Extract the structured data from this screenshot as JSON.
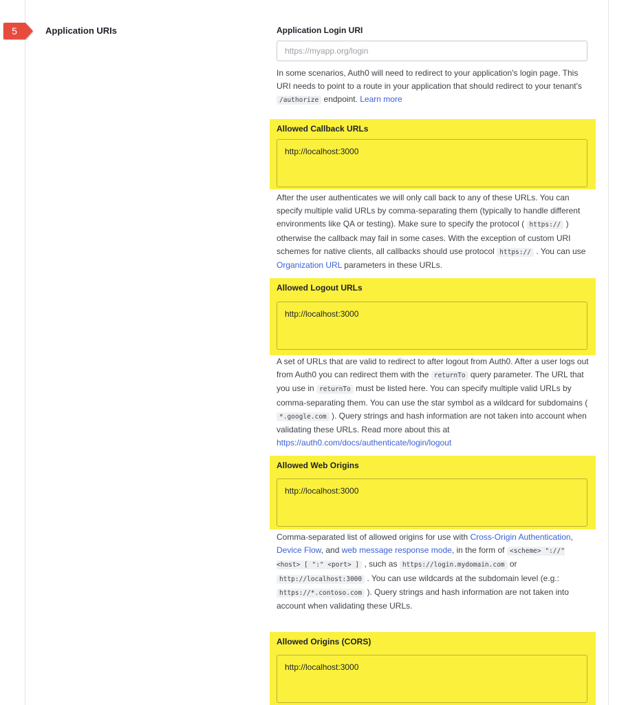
{
  "section": {
    "step_number": "5",
    "title": "Application URIs",
    "colors": {
      "badge": "#e74c3c",
      "highlight": "#fbf13c",
      "link": "#3b5fd6"
    }
  },
  "login_uri": {
    "label": "Application Login URI",
    "placeholder": "https://myapp.org/login",
    "help": {
      "t1": "In some scenarios, Auth0 will need to redirect to your application's login page. This URI needs to point to a route in your application that should redirect to your tenant's ",
      "c1": "/authorize",
      "t2": " endpoint. ",
      "link": "Learn more"
    }
  },
  "callback": {
    "label": "Allowed Callback URLs",
    "value": "http://localhost:3000",
    "help": {
      "t1": "After the user authenticates we will only call back to any of these URLs. You can specify multiple valid URLs by comma-separating them (typically to handle different environments like QA or testing). Make sure to specify the protocol ( ",
      "c1": "https://",
      "t2": " ) otherwise the callback may fail in some cases. With the exception of custom URI schemes for native clients, all callbacks should use protocol ",
      "c2": "https://",
      "t3": " . You can use ",
      "link": "Organization URL",
      "t4": " parameters in these URLs."
    }
  },
  "logout": {
    "label": "Allowed Logout URLs",
    "value": "http://localhost:3000",
    "help": {
      "t1": "A set of URLs that are valid to redirect to after logout from Auth0. After a user logs out from Auth0 you can redirect them with the ",
      "c1": "returnTo",
      "t2": " query parameter. The URL that you use in ",
      "c2": "returnTo",
      "t3": " must be listed here. You can specify multiple valid URLs by comma-separating them. You can use the star symbol as a wildcard for subdomains ( ",
      "c3": "*.google.com",
      "t4": " ). Query strings and hash information are not taken into account when validating these URLs. Read more about this at ",
      "link": "https://auth0.com/docs/authenticate/login/logout"
    }
  },
  "web_origins": {
    "label": "Allowed Web Origins",
    "value": "http://localhost:3000",
    "help": {
      "t1": "Comma-separated list of allowed origins for use with ",
      "link1": "Cross-Origin Authentication",
      "t2": ", ",
      "link2": "Device Flow",
      "t3": ", and ",
      "link3": "web message response mode",
      "t4": ", in the form of ",
      "c1": "<scheme> \"://\" <host> [ \":\" <port> ]",
      "t5": " , such as ",
      "c2": "https://login.mydomain.com",
      "t6": " or ",
      "c3": "http://localhost:3000",
      "t7": " . You can use wildcards at the subdomain level (e.g.: ",
      "c4": "https://*.contoso.com",
      "t8": " ). Query strings and hash information are not taken into account when validating these URLs."
    }
  },
  "cors": {
    "label": "Allowed Origins (CORS)",
    "value": "http://localhost:3000"
  }
}
